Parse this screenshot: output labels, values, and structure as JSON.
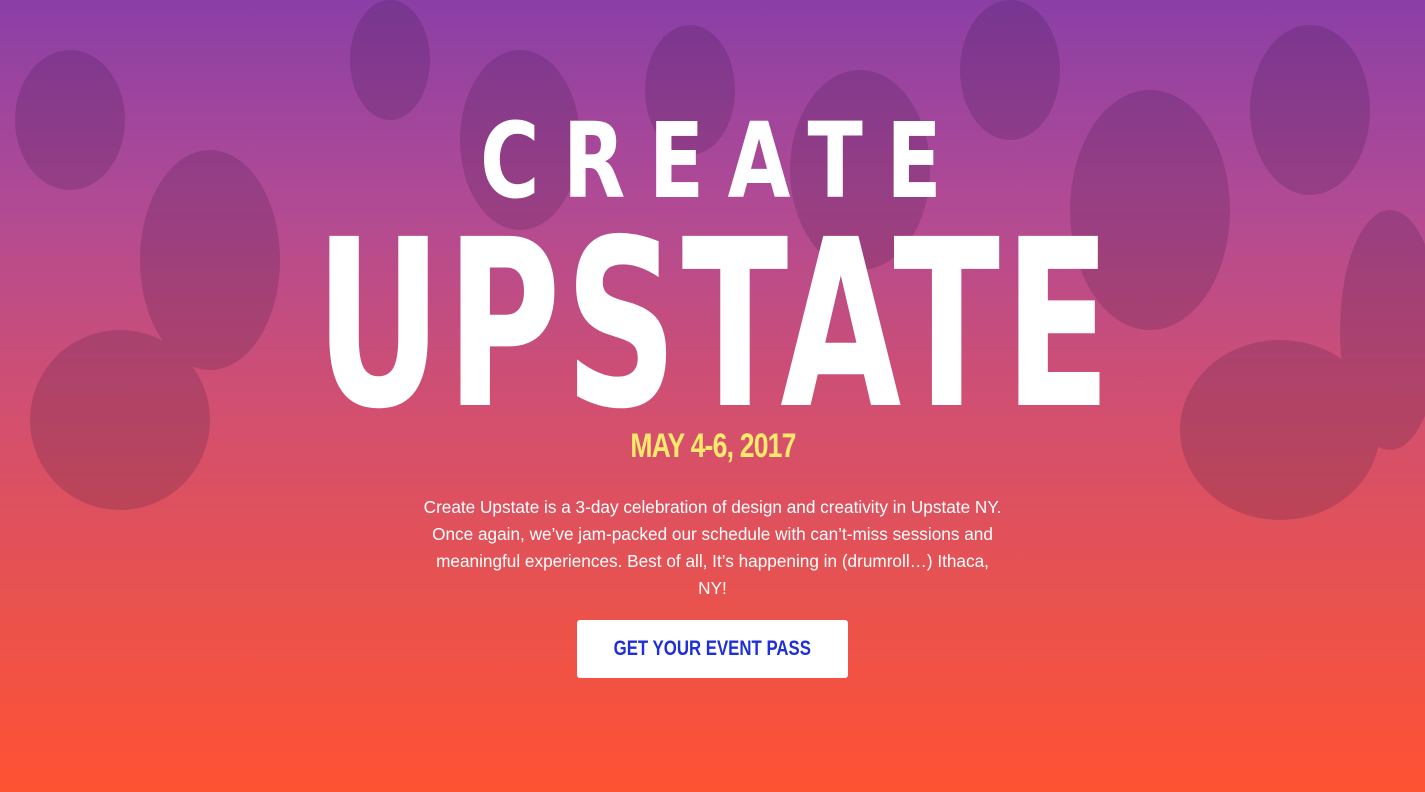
{
  "hero": {
    "logo": {
      "line1": "CREATE",
      "line2": "UPSTATE"
    },
    "date": "MAY 4-6, 2017",
    "description": "Create Upstate is a 3-day celebration of design and creativity in Upstate NY. Once again, we’ve jam-packed our schedule with can’t-miss sessions and meaningful experiences. Best of all, It’s happening in (drumroll…) Ithaca, NY!",
    "cta_label": "GET YOUR EVENT PASS"
  },
  "colors": {
    "gradient_top": "#8a3fa6",
    "gradient_bottom": "#ff5233",
    "date_yellow": "#fde96e",
    "cta_text": "#1f2fd8",
    "cta_background": "#ffffff",
    "logo_text": "#ffffff"
  }
}
